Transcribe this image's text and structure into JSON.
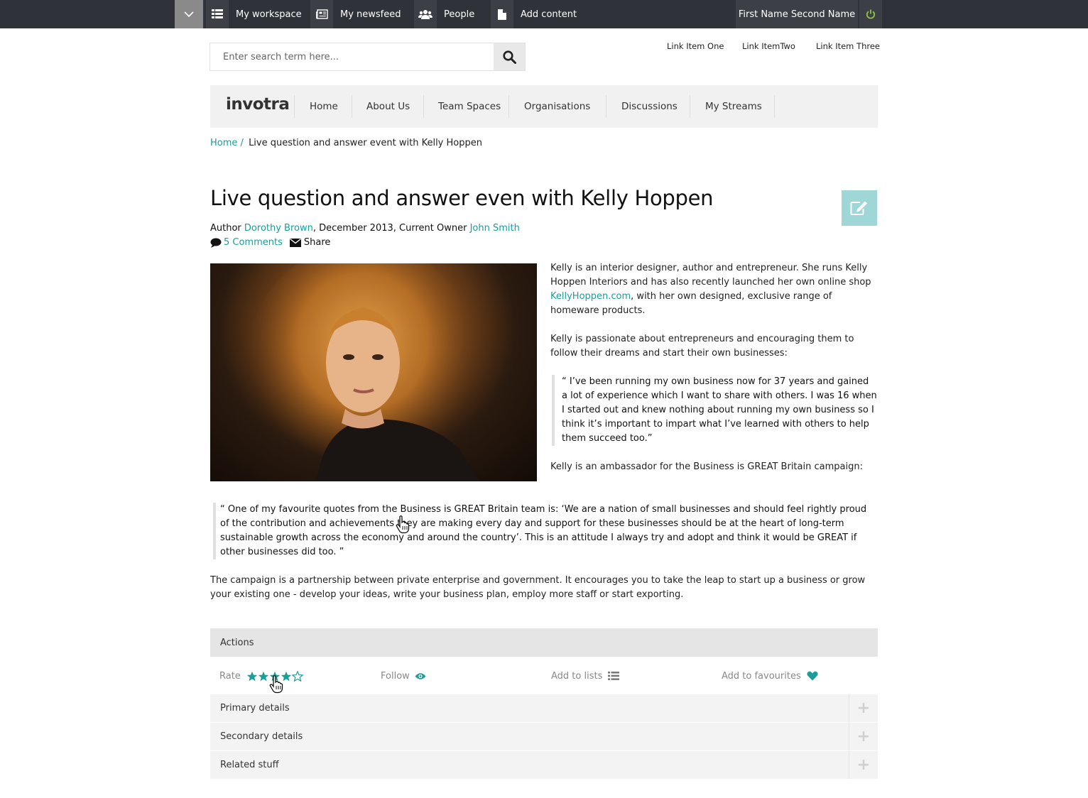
{
  "topbar": {
    "workspace": "My workspace",
    "newsfeed": "My newsfeed",
    "people": "People",
    "add_content": "Add content",
    "user_name": "First Name Second Name"
  },
  "search": {
    "placeholder": "Enter search term here..."
  },
  "top_links": [
    "Link Item One",
    "Link ItemTwo",
    "Link Item Three"
  ],
  "nav": {
    "logo": "invotra",
    "items": [
      "Home",
      "About Us",
      "Team Spaces",
      "Organisations",
      "Discussions",
      "My Streams"
    ]
  },
  "breadcrumb": {
    "home": "Home",
    "sep": "/",
    "current": "Live question and answer event with Kelly Hoppen"
  },
  "article": {
    "title": "Live question and answer even with Kelly Hoppen",
    "author_label": "Author",
    "author": "Dorothy Brown",
    "date": ", December 2013, Current Owner",
    "owner": "John Smith",
    "comments": "5 Comments",
    "share": "Share",
    "p1_a": "Kelly is an interior designer, author and entrepreneur. She runs Kelly Hoppen Interiors and has also recently launched her own online shop ",
    "p1_link": "KellyHoppen.com",
    "p1_b": ", with her own designed, exclusive range of homeware products.",
    "p2": "Kelly is passionate about entrepreneurs and encouraging them to follow their dreams and start their own businesses:",
    "quote1": "“ I’ve been running my own business now for 37 years and gained a lot of experience which I want to share with others. I was 16 when I started out and knew nothing about running my own business so I think it’s important to impart what I’ve learned with others to help them succeed too.”",
    "p3": "Kelly is an ambassador for the Business is GREAT Britain campaign:",
    "quote2": "“ One of my favourite quotes from the Business is GREAT Britain team is: ‘We are a nation of small businesses and should feel rightly proud of the contribution and achievements they are making every day and support for these businesses should be at the heart of long-term sustainable growth across the economy and around the country’. This is an attitude I always try and adopt and think it would be GREAT if other businesses did too. ”",
    "p4": "The campaign is a partnership between private enterprise and government. It encourages you to take the leap to start up a business or grow your existing one - develop your ideas, write your business plan, employ more staff or start exporting."
  },
  "actions": {
    "heading": "Actions",
    "rate": "Rate",
    "rating": 4,
    "rating_max": 5,
    "follow": "Follow",
    "add_to_lists": "Add to lists",
    "add_to_favourites": "Add to favourites"
  },
  "accordions": [
    "Primary details",
    "Secondary details",
    "Related stuff"
  ],
  "colors": {
    "accent": "#1a9e9a",
    "topbar": "#2f3238",
    "power": "#8cc63f"
  }
}
